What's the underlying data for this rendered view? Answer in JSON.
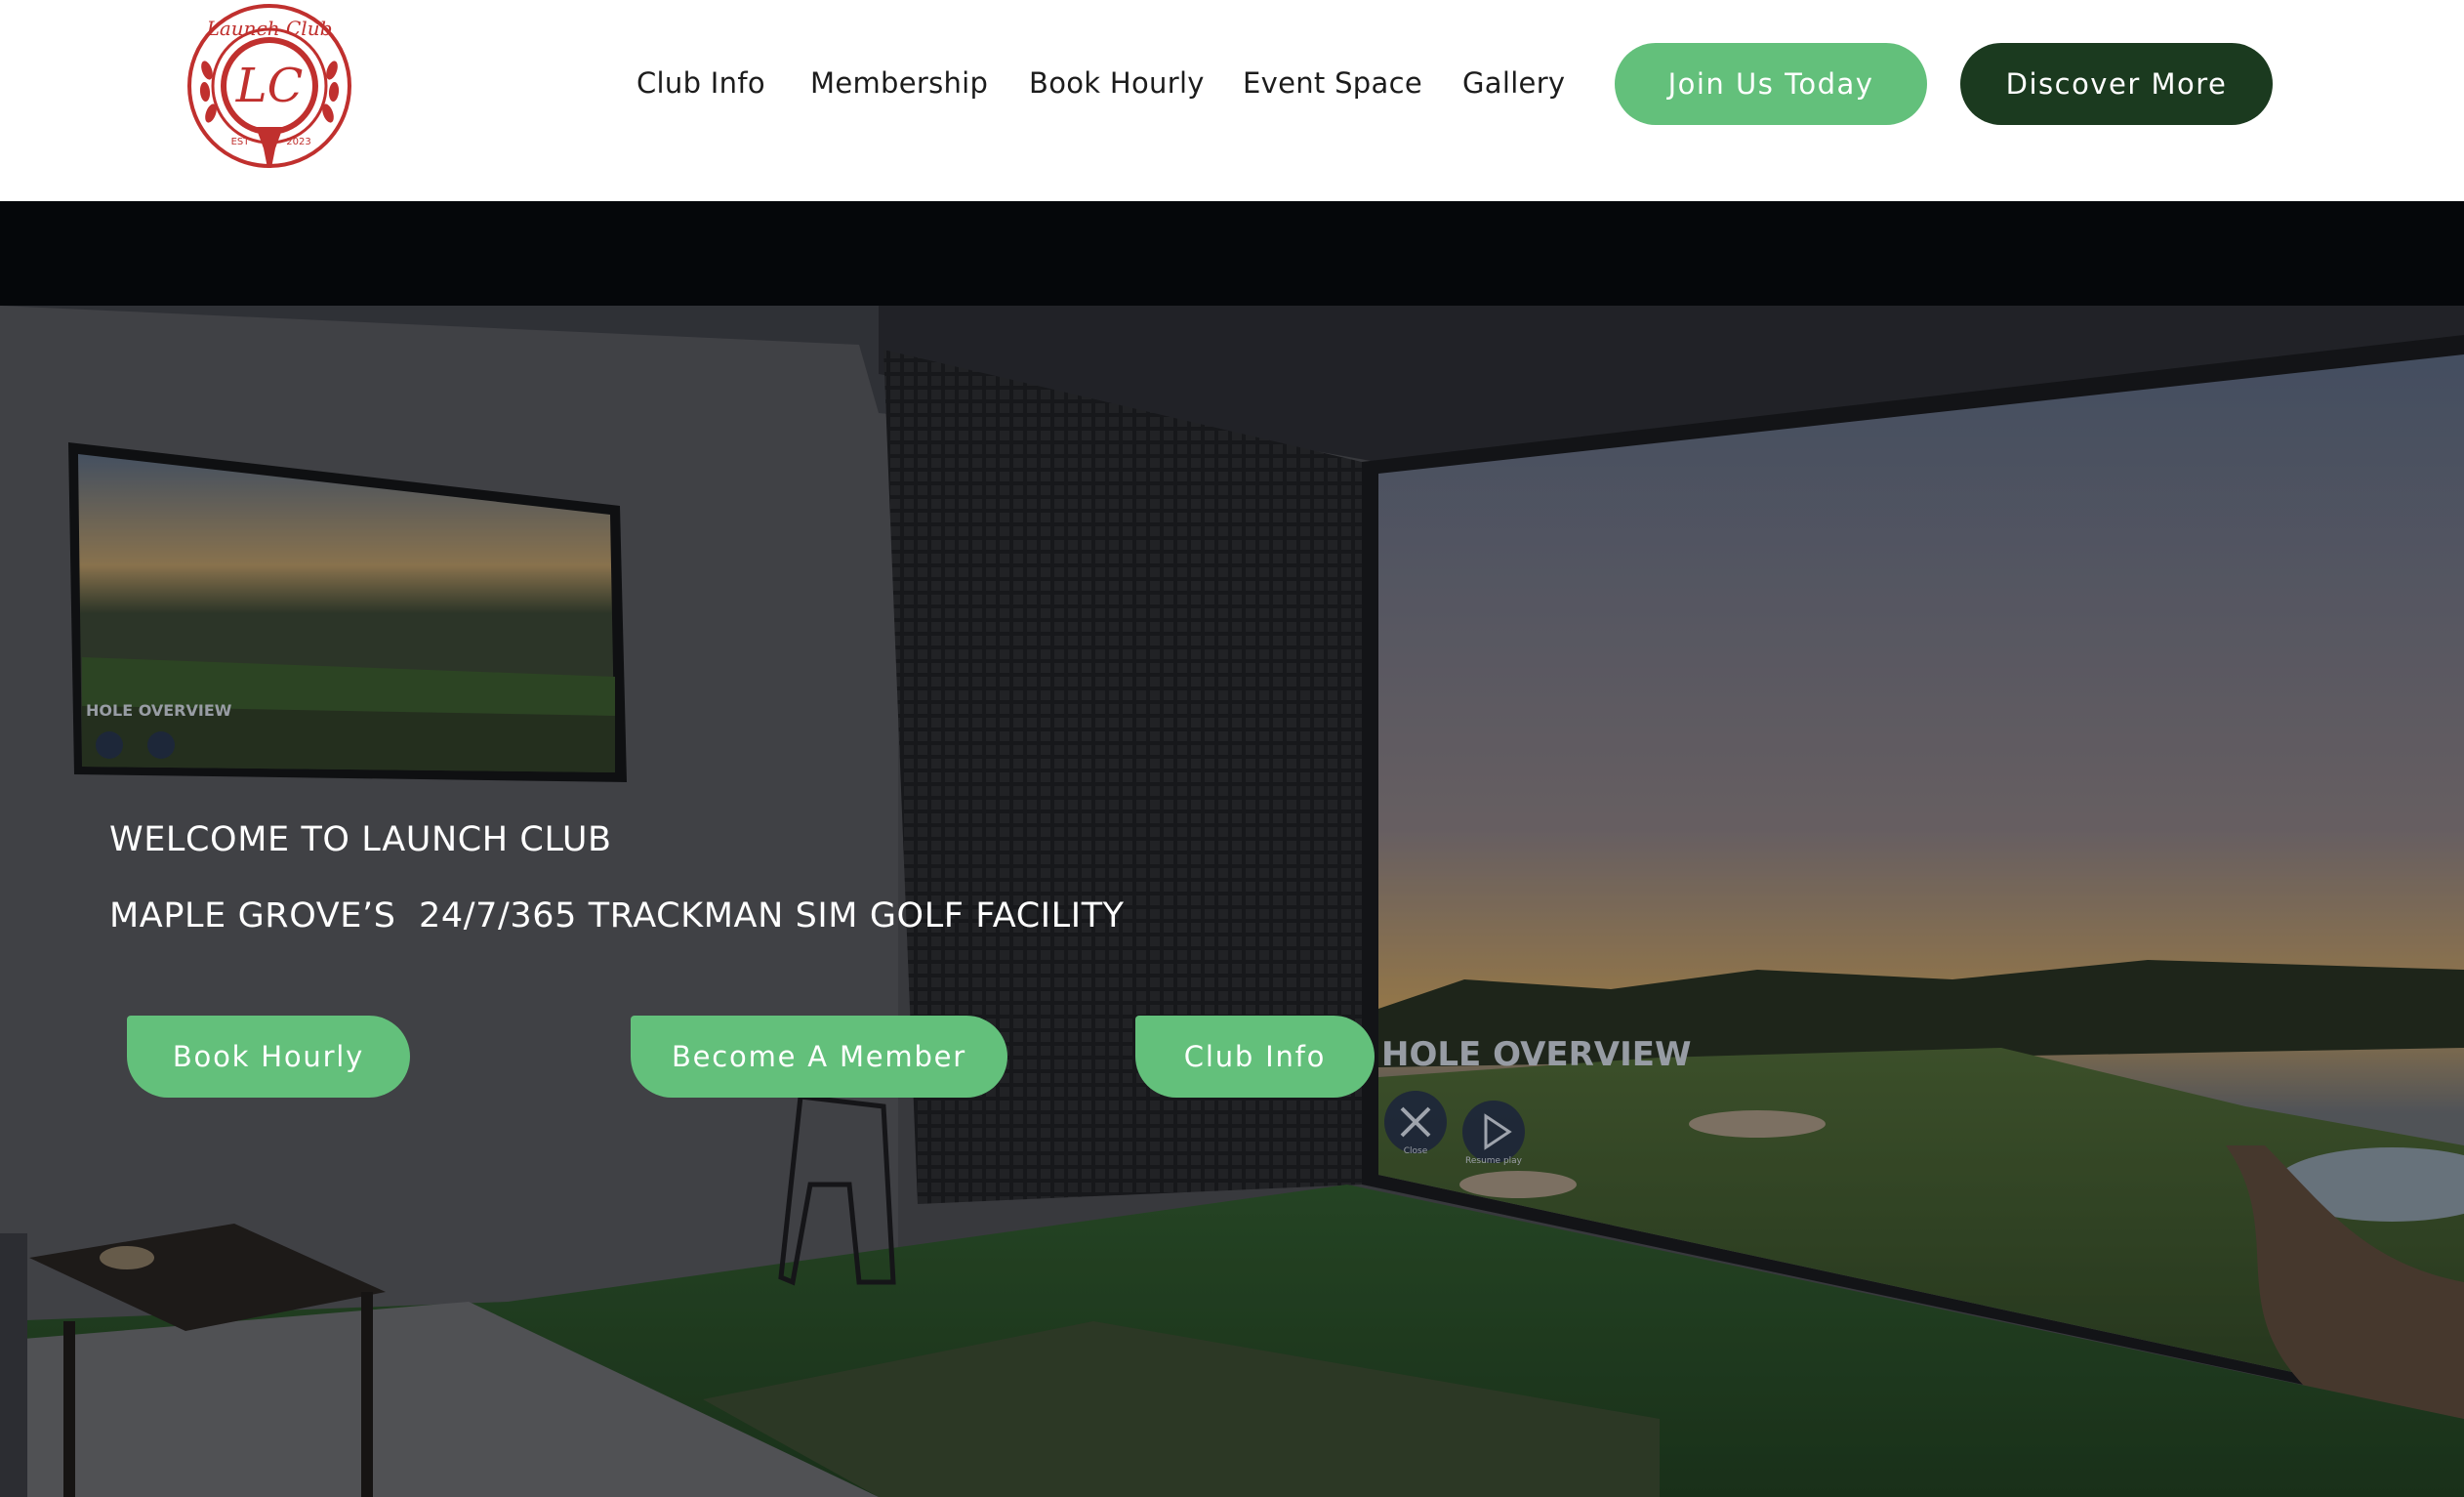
{
  "brand": {
    "logo_text": "Launch Club",
    "logo_monogram": "LC",
    "logo_est": "EST",
    "logo_year": "2023",
    "primary_color": "#63c07b",
    "dark_color": "#1b3a1f",
    "logo_color": "#c0302e"
  },
  "nav": {
    "items": [
      {
        "label": "Club Info"
      },
      {
        "label": "Membership"
      },
      {
        "label": "Book Hourly"
      },
      {
        "label": "Event Space"
      },
      {
        "label": "Gallery"
      }
    ],
    "join_label": "Join Us Today",
    "discover_label": "Discover More"
  },
  "hero": {
    "line1": "WELCOME TO LAUNCH CLUB",
    "line2": "MAPLE GROVE’S  24/7/365 TRACKMAN SIM GOLF FACILITY",
    "buttons": [
      {
        "label": "Book Hourly"
      },
      {
        "label": "Become A Member"
      },
      {
        "label": "Club Info"
      }
    ],
    "tv_overlay_text": "HOLE OVERVIEW",
    "screen_overlay_text": "HOLE OVERVIEW",
    "screen_close_label": "Close",
    "screen_resume_label": "Resume play"
  }
}
